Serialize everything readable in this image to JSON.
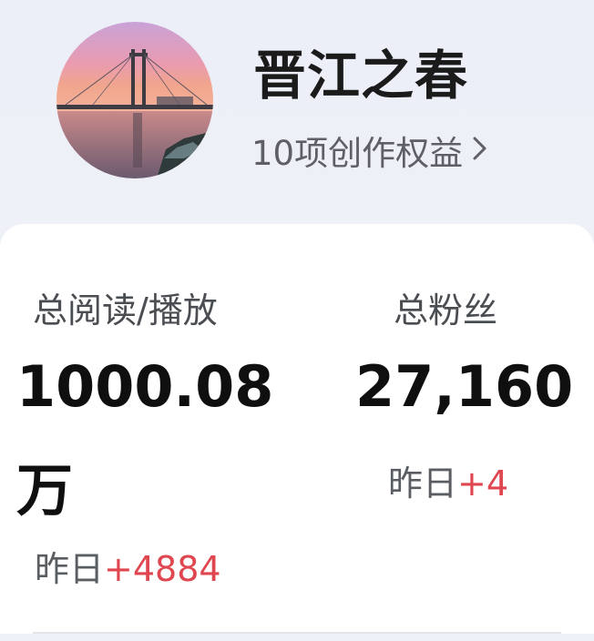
{
  "profile": {
    "name": "晋江之春",
    "perks_label": "10项创作权益",
    "avatar_icon": "bridge-sunset-avatar",
    "chevron_icon": "chevron-right-icon"
  },
  "stats": {
    "reads": {
      "label": "总阅读/播放",
      "value_line1": "1000.08",
      "value_line2": "万",
      "yesterday_label": "昨日",
      "yesterday_delta": "+4884"
    },
    "fans": {
      "label": "总粉丝",
      "value": "27,160",
      "yesterday_label": "昨日",
      "yesterday_delta": "+4"
    }
  },
  "colors": {
    "accent_red": "#e0464f",
    "text_dark": "#0f0f0f",
    "text_gray": "#5e6066"
  }
}
